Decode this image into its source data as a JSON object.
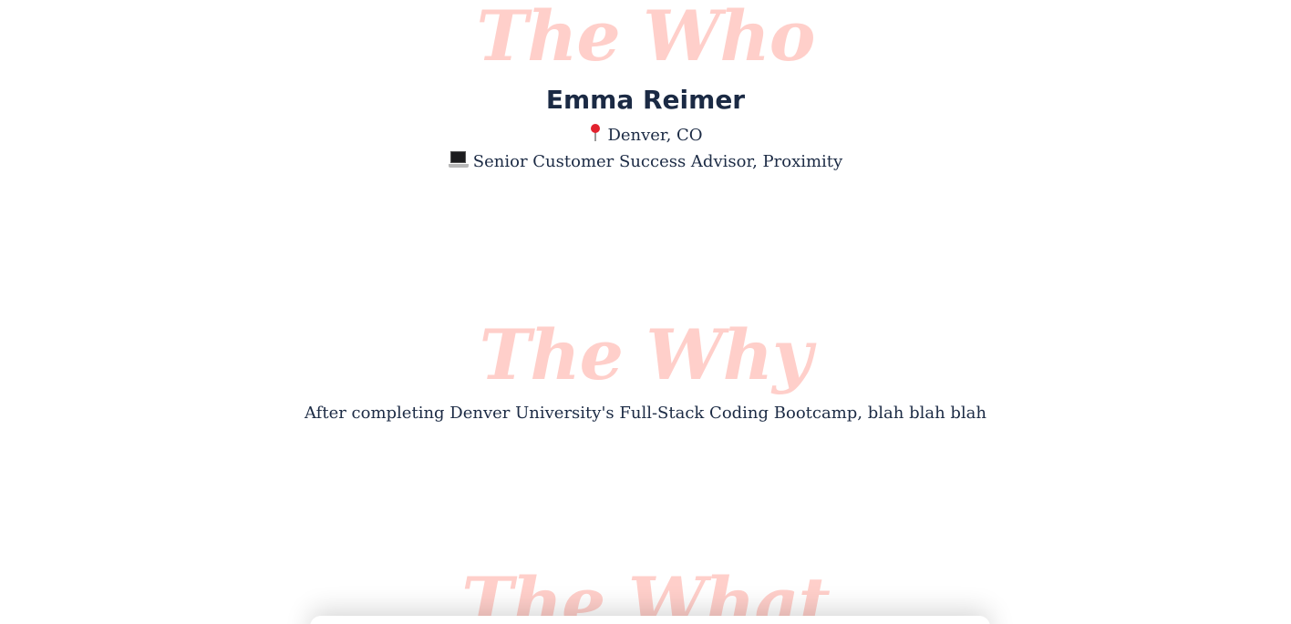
{
  "sections": {
    "who": {
      "title": "The Who",
      "name": "Emma Reimer",
      "location_icon": "round-pushpin-icon",
      "location": "Denver, CO",
      "job_icon": "laptop-icon",
      "job": "Senior Customer Success Advisor, Proximity"
    },
    "why": {
      "title": "The Why",
      "text": "After completing Denver University's Full-Stack Coding Bootcamp, blah blah blah"
    },
    "what": {
      "title": "The What"
    }
  },
  "colors": {
    "heading_pink": "#ffcfca",
    "text_navy": "#1b2a44",
    "background": "#ffffff"
  }
}
